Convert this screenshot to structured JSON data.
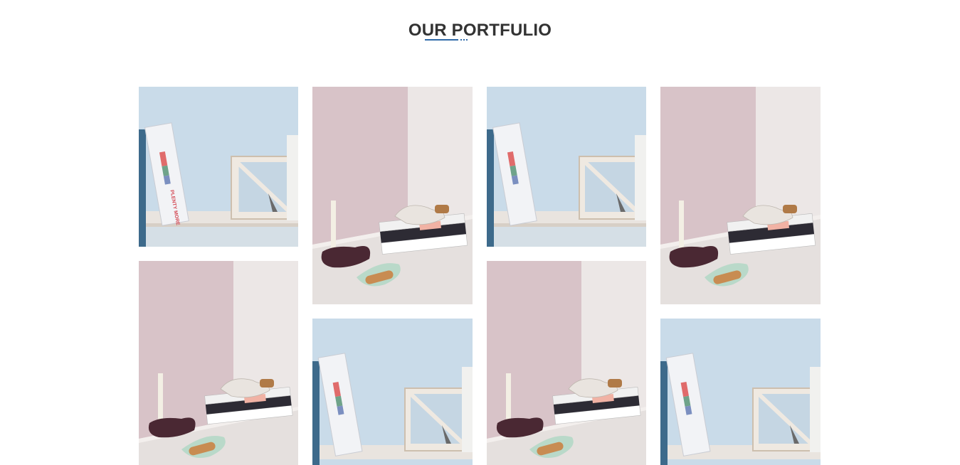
{
  "section": {
    "title": "OUR PORTFULIO"
  },
  "colors": {
    "title": "#333333",
    "accent": "#2f6aa8",
    "blue_wall": "#c9dbe9",
    "pink_wall": "#d8c3c8",
    "cream_wall": "#ece7e6",
    "shelf": "#e9e6e4"
  },
  "portfolio": {
    "items": [
      {
        "scene": "blue-shelf-book"
      },
      {
        "scene": "pink-still-life"
      },
      {
        "scene": "blue-shelf-book"
      },
      {
        "scene": "pink-still-life"
      },
      {
        "scene": "pink-still-life"
      },
      {
        "scene": "blue-shelf-book"
      },
      {
        "scene": "pink-still-life"
      },
      {
        "scene": "blue-shelf-book"
      }
    ],
    "book_spine_text": "PLENTY MORE"
  }
}
